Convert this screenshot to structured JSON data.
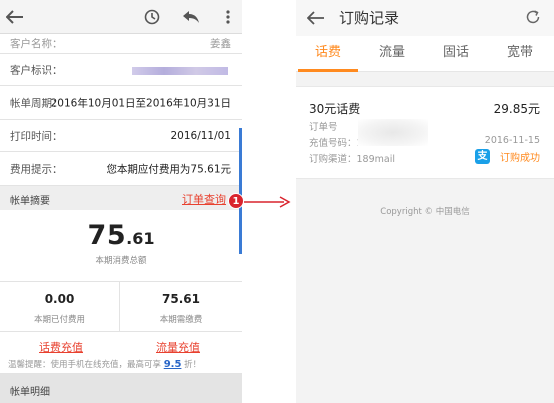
{
  "left": {
    "partial_row": {
      "label": "客户名称：",
      "value": "姜鑫"
    },
    "rows": [
      {
        "label": "客户标识：",
        "value": ""
      },
      {
        "label": "帐单周期：",
        "value": "2016年10月01日至2016年10月31日"
      },
      {
        "label": "打印时间：",
        "value": "2016/11/01"
      },
      {
        "label": "费用提示：",
        "value": "您本期应付费用为75.61元"
      }
    ],
    "summary": {
      "label": "帐单摘要",
      "link": "订单查询"
    },
    "total": {
      "integer": "75",
      "decimal": ".61",
      "caption": "本期消费总额"
    },
    "split": [
      {
        "value": "0.00",
        "caption": "本期已付费用"
      },
      {
        "value": "75.61",
        "caption": "本期需缴费"
      }
    ],
    "recharge": {
      "phone": "话费充值",
      "data": "流量充值",
      "tip_prefix": "温馨提醒：使用手机在线充值，最高可享",
      "tip_discount": "9.5",
      "tip_suffix": "折！"
    },
    "detail": {
      "label": "帐单明细"
    }
  },
  "callout": {
    "number": "1"
  },
  "right": {
    "title": "订购记录",
    "tabs": [
      {
        "label": "话费",
        "active": true
      },
      {
        "label": "流量",
        "active": false
      },
      {
        "label": "固话",
        "active": false
      },
      {
        "label": "宽带",
        "active": false
      }
    ],
    "card": {
      "title": "30元话费",
      "price": "29.85元",
      "order_label": "订单号",
      "phone_label": "充值号码：1",
      "channel_label": "订购渠道：189mail",
      "date": "2016-11-15",
      "status": "订购成功",
      "pay_glyph": "支"
    },
    "copyright": "Copyright © 中国电信"
  },
  "colors": {
    "accent": "#ff8a1f",
    "link_red": "#e8412f",
    "scroll_blue": "#3a7bd5",
    "pay_blue": "#1aa0e8",
    "badge_red": "#d9232d"
  }
}
